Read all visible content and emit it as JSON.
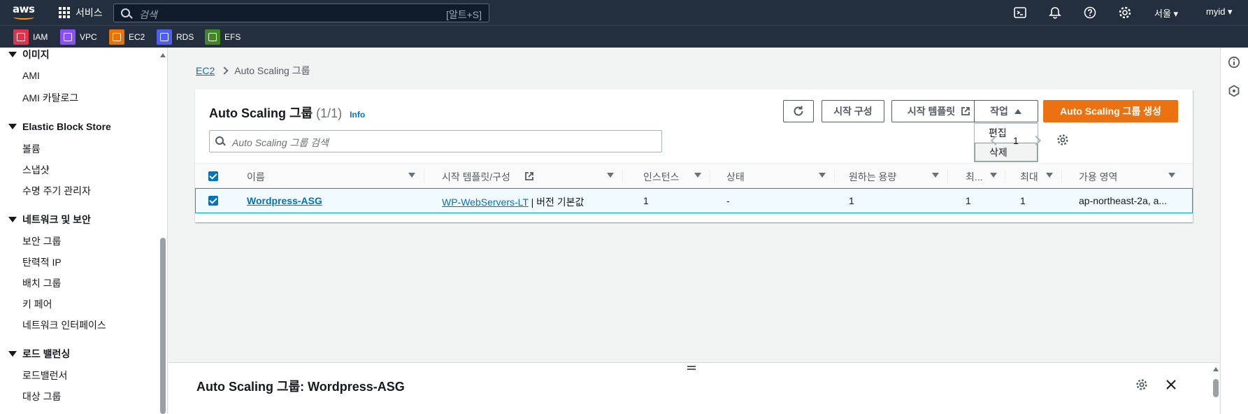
{
  "nav": {
    "logo": "aws",
    "services_label": "서비스",
    "search_placeholder": "검색",
    "search_shortcut": "[알트+S]",
    "region": "서울 ▾",
    "user": "myid ▾"
  },
  "favorites": [
    {
      "label": "IAM",
      "color": "#dd344c"
    },
    {
      "label": "VPC",
      "color": "#8c4fff"
    },
    {
      "label": "EC2",
      "color": "#ed7100"
    },
    {
      "label": "RDS",
      "color": "#4d5ff0"
    },
    {
      "label": "EFS",
      "color": "#3f8624"
    }
  ],
  "sidebar": {
    "sections": [
      {
        "title": "이미지",
        "items": [
          "AMI",
          "AMI 카탈로그"
        ]
      },
      {
        "title": "Elastic Block Store",
        "items": [
          "볼륨",
          "스냅샷",
          "수명 주기 관리자"
        ]
      },
      {
        "title": "네트워크 및 보안",
        "items": [
          "보안 그룹",
          "탄력적 IP",
          "배치 그룹",
          "키 페어",
          "네트워크 인터페이스"
        ]
      },
      {
        "title": "로드 밸런싱",
        "items": [
          "로드밸런서",
          "대상 그룹"
        ]
      }
    ]
  },
  "breadcrumb": {
    "parent": "EC2",
    "current": "Auto Scaling 그룹"
  },
  "panel": {
    "title": "Auto Scaling 그룹",
    "count": "(1/1)",
    "info": "Info",
    "buttons": {
      "launch_config": "시작 구성",
      "launch_template": "시작 템플릿",
      "actions": "작업",
      "create": "Auto Scaling 그룹 생성"
    },
    "actions_menu": [
      "편집",
      "삭제"
    ],
    "search_placeholder": "Auto Scaling 그룹 검색",
    "page": "1"
  },
  "table": {
    "columns": [
      "이름",
      "시작 템플릿/구성",
      "인스턴스",
      "상태",
      "원하는 용량",
      "최...",
      "최대",
      "가용 영역"
    ],
    "rows": [
      {
        "name": "Wordpress-ASG",
        "template_link": "WP-WebServers-LT",
        "template_version": "| 버전 기본값",
        "instances": "1",
        "status": "-",
        "desired": "1",
        "min": "1",
        "max": "1",
        "az": "ap-northeast-2a, a..."
      }
    ]
  },
  "split_panel": {
    "title": "Auto Scaling 그룹: Wordpress-ASG"
  },
  "colors": {
    "accent": "#ec7211",
    "link": "#0073bb",
    "nav_bg": "#232f3e"
  }
}
